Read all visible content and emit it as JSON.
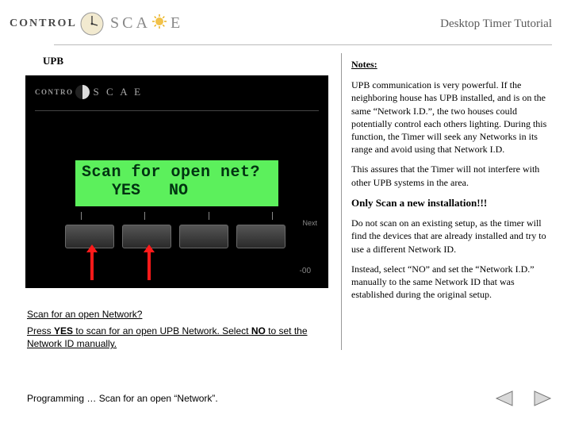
{
  "header": {
    "logo_control": "CONTROL",
    "logo_scape": "SCA   E",
    "tutorial_title": "Desktop Timer Tutorial"
  },
  "section_title": "UPB",
  "device": {
    "logo_control": "CONTRO",
    "logo_scape": "S C A    E",
    "lcd_line1": "Scan for open net?",
    "lcd_yes": "YES",
    "lcd_no": "NO",
    "next_label": "Next",
    "minus": "-00"
  },
  "caption": {
    "title": "Scan for an open Network?",
    "pre": "Press ",
    "yes": "YES",
    "mid": " to scan for an open UPB Network.  Select ",
    "no": "NO",
    "post": " to set the Network ID manually."
  },
  "notes": {
    "heading": "Notes:",
    "p1": "UPB communication is very powerful. If the neighboring house has UPB installed, and is on the same “Network I.D.”, the two houses could potentially control each others lighting. During this function, the Timer will seek any Networks in its range and avoid using that Network I.D.",
    "p2": "This assures that the Timer will not interfere with other UPB systems in the area.",
    "p3": "Only Scan  a new installation!!!",
    "p4": "Do not scan on an existing setup, as the timer will find the devices that are already installed and try to use a different Network ID.",
    "p5": "Instead, select “NO” and set the “Network I.D.” manually to the same Network ID that was established during the original setup."
  },
  "footer": {
    "text": "Programming … Scan for an open “Network”."
  }
}
